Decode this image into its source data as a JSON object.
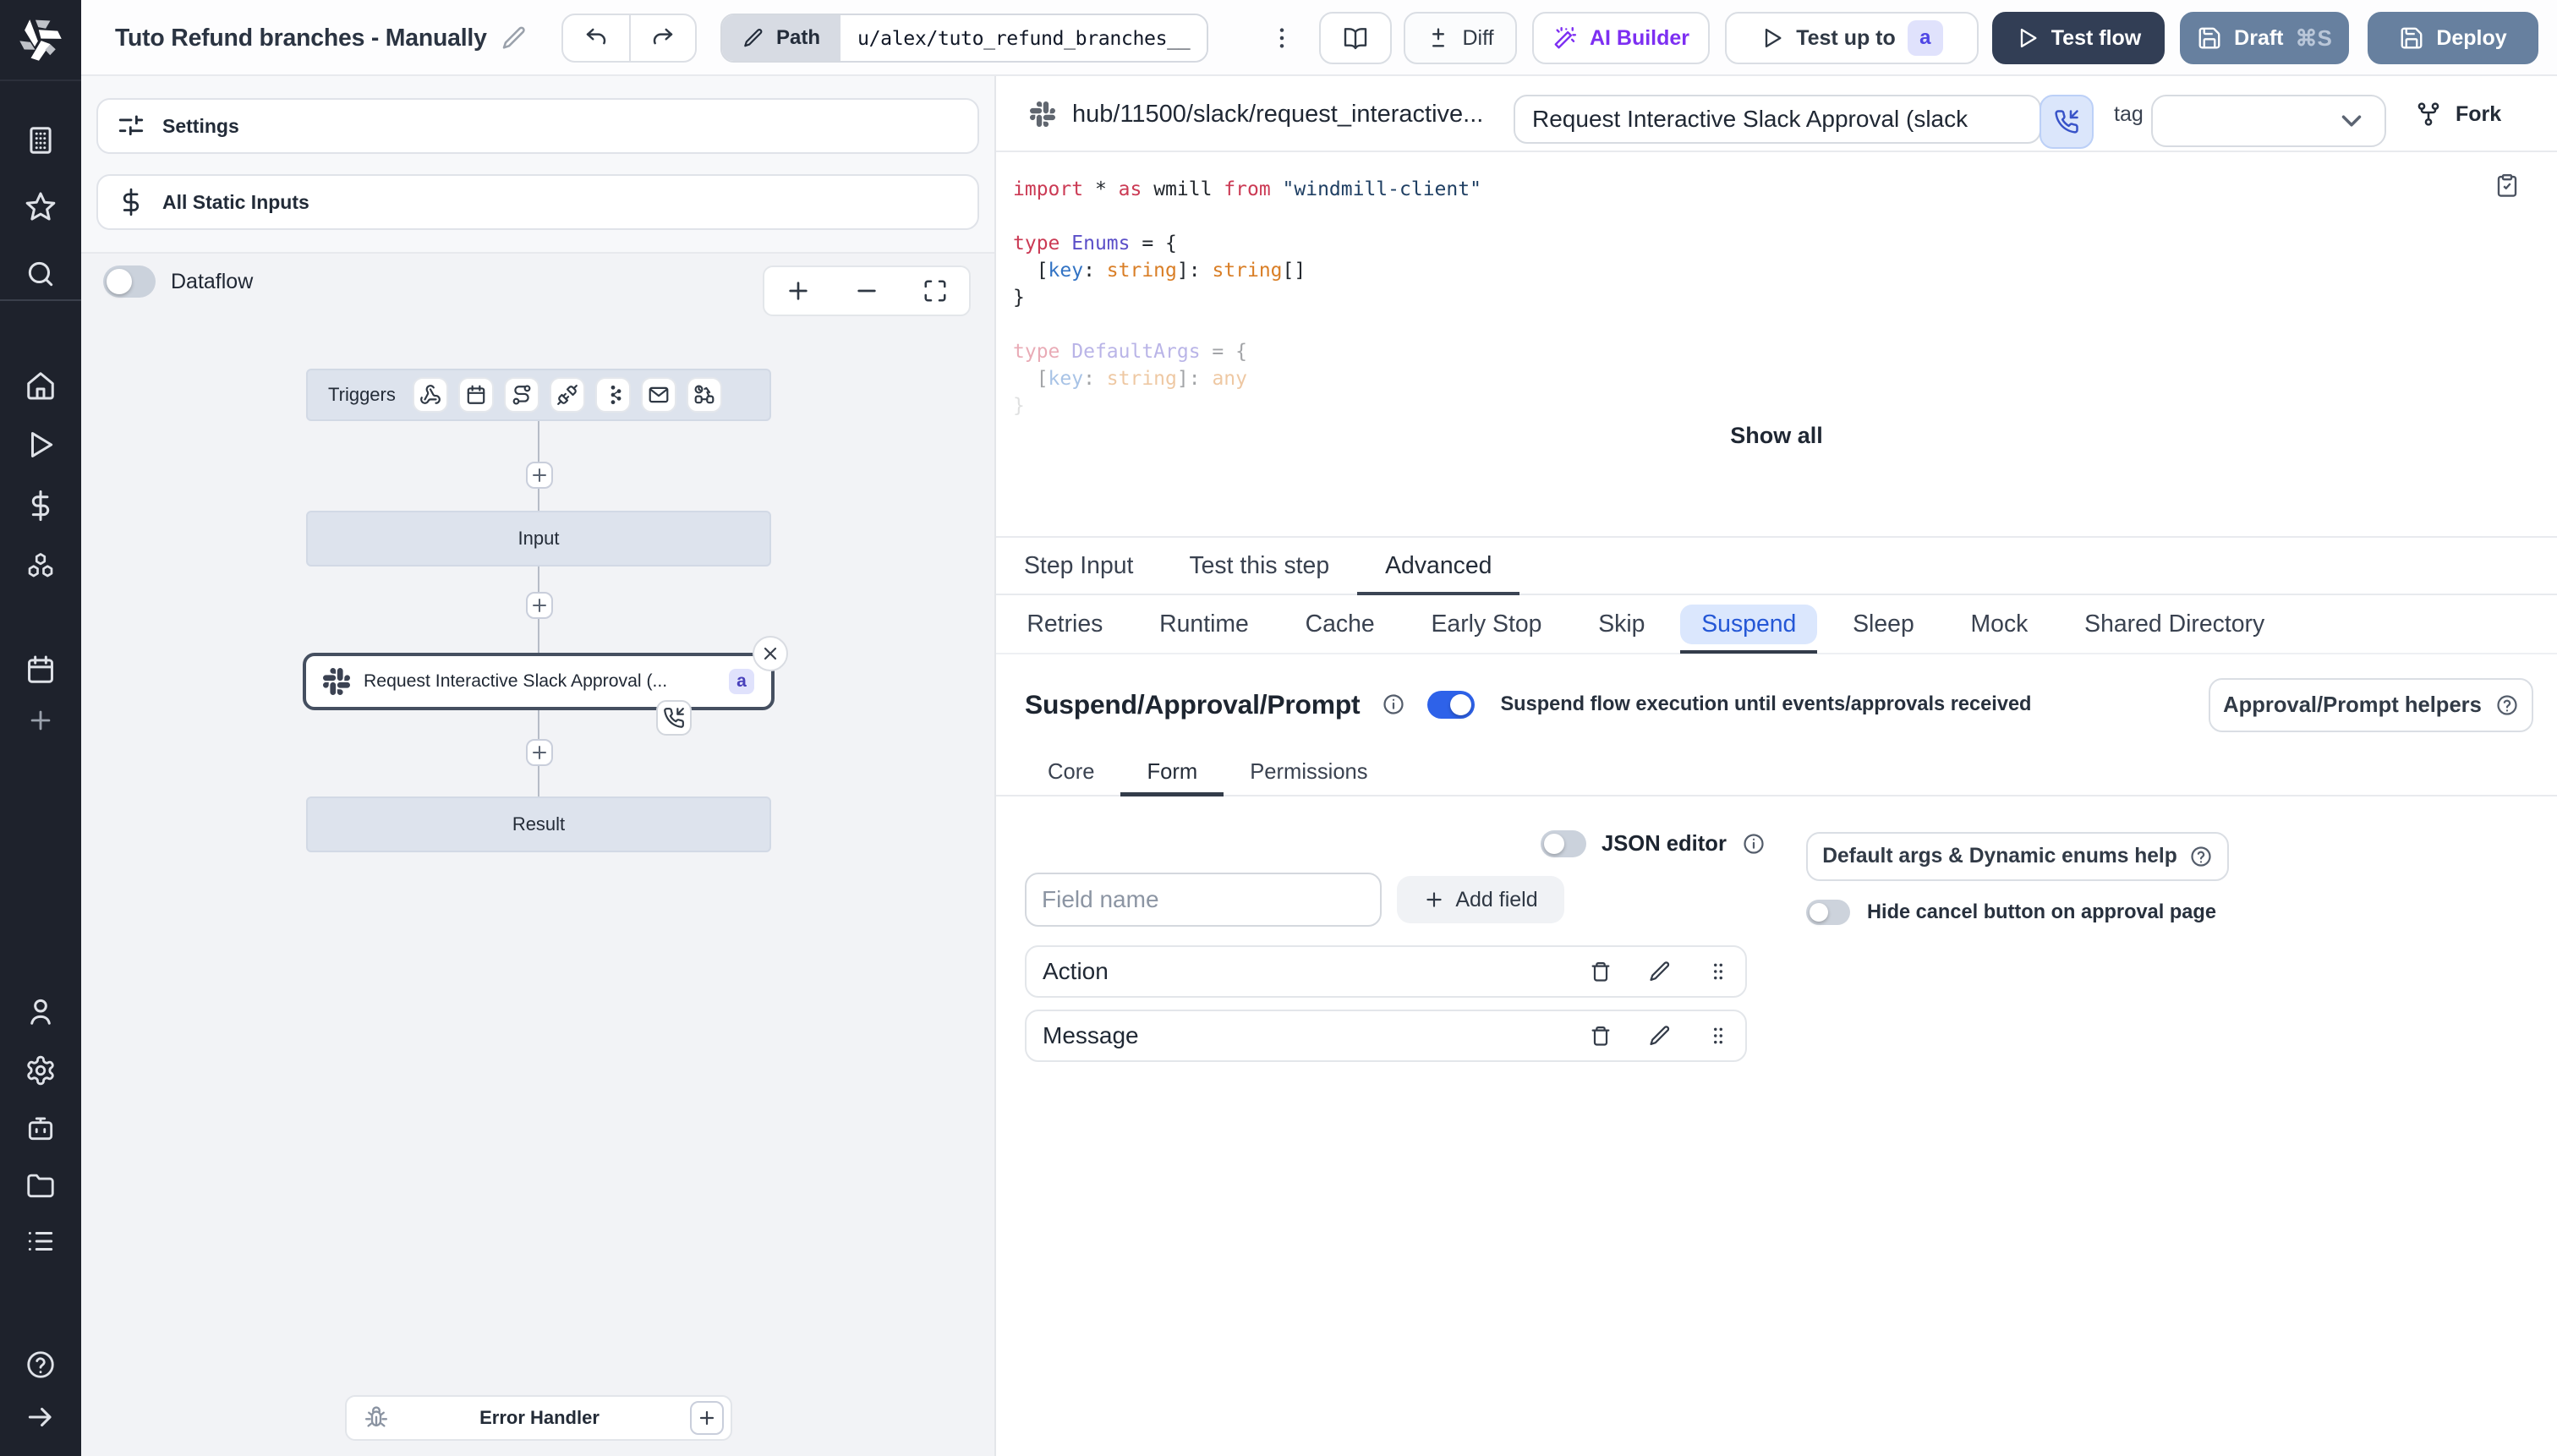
{
  "topbar": {
    "title": "Tuto Refund branches - Manually",
    "path_label": "Path",
    "path_value": "u/alex/tuto_refund_branches__",
    "diff_label": "Diff",
    "ai_builder_label": "AI Builder",
    "test_up_to_label": "Test up to",
    "test_up_to_badge": "a",
    "test_flow_label": "Test flow",
    "draft_label": "Draft",
    "draft_shortcut": "⌘S",
    "deploy_label": "Deploy"
  },
  "flow_panel": {
    "settings_label": "Settings",
    "static_inputs_label": "All Static Inputs",
    "dataflow_label": "Dataflow",
    "triggers_label": "Triggers",
    "input_node_label": "Input",
    "step_node_label": "Request Interactive Slack Approval (...",
    "step_node_badge": "a",
    "result_node_label": "Result",
    "error_handler_label": "Error Handler"
  },
  "module_bar": {
    "hub_path": "hub/11500/slack/request_interactive...",
    "summary_value": "Request Interactive Slack Approval (slack",
    "tag_label": "tag",
    "fork_label": "Fork"
  },
  "editor": {
    "show_all_label": "Show all",
    "lines": [
      {
        "opacity": 1,
        "tokens": [
          {
            "t": "import",
            "c": "k"
          },
          {
            "t": " * ",
            "c": "p"
          },
          {
            "t": "as",
            "c": "k"
          },
          {
            "t": " wmill ",
            "c": "p"
          },
          {
            "t": "from",
            "c": "k"
          },
          {
            "t": " ",
            "c": "p"
          },
          {
            "t": "\"windmill-client\"",
            "c": "s"
          }
        ]
      },
      {
        "opacity": 1,
        "tokens": []
      },
      {
        "opacity": 1,
        "tokens": [
          {
            "t": "type",
            "c": "k"
          },
          {
            "t": " ",
            "c": "p"
          },
          {
            "t": "Enums",
            "c": "ty"
          },
          {
            "t": " = {",
            "c": "p"
          }
        ]
      },
      {
        "opacity": 1,
        "tokens": [
          {
            "t": "  [",
            "c": "p"
          },
          {
            "t": "key",
            "c": "v"
          },
          {
            "t": ": ",
            "c": "p"
          },
          {
            "t": "string",
            "c": "o"
          },
          {
            "t": "]: ",
            "c": "p"
          },
          {
            "t": "string",
            "c": "o"
          },
          {
            "t": "[]",
            "c": "p"
          }
        ]
      },
      {
        "opacity": 1,
        "tokens": [
          {
            "t": "}",
            "c": "p"
          }
        ]
      },
      {
        "opacity": 1,
        "tokens": []
      },
      {
        "opacity": 0.42,
        "tokens": [
          {
            "t": "type",
            "c": "k"
          },
          {
            "t": " ",
            "c": "p"
          },
          {
            "t": "DefaultArgs",
            "c": "ty"
          },
          {
            "t": " = {",
            "c": "p"
          }
        ]
      },
      {
        "opacity": 0.42,
        "tokens": [
          {
            "t": "  [",
            "c": "p"
          },
          {
            "t": "key",
            "c": "v"
          },
          {
            "t": ": ",
            "c": "p"
          },
          {
            "t": "string",
            "c": "o"
          },
          {
            "t": "]: ",
            "c": "p"
          },
          {
            "t": "any",
            "c": "o"
          }
        ]
      },
      {
        "opacity": 0.14,
        "tokens": [
          {
            "t": "}",
            "c": "p"
          }
        ]
      }
    ]
  },
  "tabs": [
    {
      "label": "Step Input",
      "active": false
    },
    {
      "label": "Test this step",
      "active": false
    },
    {
      "label": "Advanced",
      "active": true
    }
  ],
  "subtabs": [
    {
      "label": "Retries",
      "active": false
    },
    {
      "label": "Runtime",
      "active": false
    },
    {
      "label": "Cache",
      "active": false
    },
    {
      "label": "Early Stop",
      "active": false
    },
    {
      "label": "Skip",
      "active": false
    },
    {
      "label": "Suspend",
      "active": true
    },
    {
      "label": "Sleep",
      "active": false
    },
    {
      "label": "Mock",
      "active": false
    },
    {
      "label": "Shared Directory",
      "active": false
    }
  ],
  "suspend": {
    "title": "Suspend/Approval/Prompt",
    "toggle_on": true,
    "description": "Suspend flow execution until events/approvals received",
    "helpers_button_label": "Approval/Prompt helpers",
    "inner_tabs": [
      {
        "label": "Core",
        "active": false
      },
      {
        "label": "Form",
        "active": true
      },
      {
        "label": "Permissions",
        "active": false
      }
    ],
    "json_editor_label": "JSON editor",
    "default_args_help_label": "Default args & Dynamic enums help",
    "field_name_placeholder": "Field name",
    "add_field_label": "Add field",
    "hide_cancel_label": "Hide cancel button on approval page",
    "fields": [
      {
        "name": "Action"
      },
      {
        "name": "Message"
      }
    ]
  },
  "colors": {
    "accent_blue": "#2e62e9",
    "suspend_tab_blue": "#2457d6",
    "ai_purple": "#7d2ff2",
    "dark_button": "#323e55",
    "slate_button": "#67809f",
    "badge_bg": "#e0e2fc",
    "badge_text": "#4f46e5"
  }
}
